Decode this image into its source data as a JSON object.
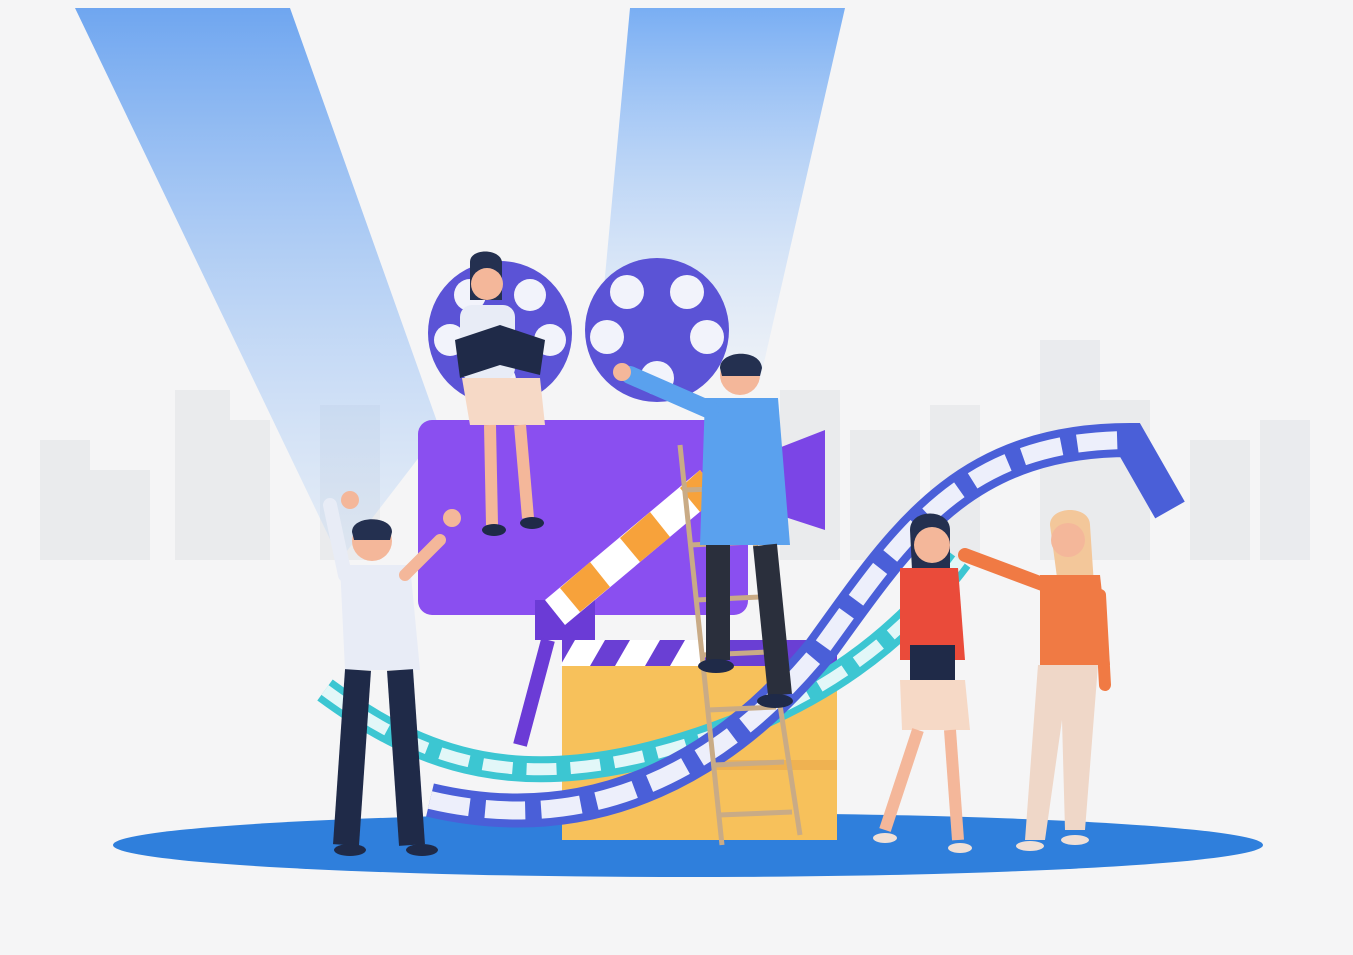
{
  "scene": {
    "subject": "film-production-illustration",
    "colors": {
      "background": "#f5f5f6",
      "skyline": "#e6e7ea",
      "spotlight": "#6fa6f0",
      "ground": "#2f7fdc",
      "camera_body": "#8a4ff0",
      "camera_body_dark": "#6b3bd6",
      "reel": "#5b53d6",
      "reel_hole": "#f2f3fb",
      "clapper_box": "#f7c15b",
      "clapper_stripe": "#e9a84b",
      "clapper_top": "#6a3fd4",
      "film_strip": "#4a5fd8",
      "film_strip_teal": "#3cc6d2",
      "ladder": "#c9ab86",
      "skin": "#f4b79a",
      "hair_dark": "#243050",
      "hair_blonde": "#f3c79a",
      "shirt_blue": "#5aa1ee",
      "shirt_white": "#e8ecf6",
      "pants_dark": "#1f2a48",
      "top_red": "#ea4b3a",
      "top_orange": "#f07a44",
      "skirt_beige": "#f6d9c6",
      "pants_cream": "#efd7c8"
    }
  }
}
